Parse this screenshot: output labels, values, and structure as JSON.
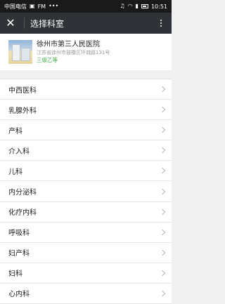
{
  "statusbar": {
    "carrier": "中国电信",
    "fm": "FM",
    "time": "10:51"
  },
  "navbar": {
    "title": "选择科室"
  },
  "hospital": {
    "name": "徐州市第三人民医院",
    "address": "江苏省徐州市鼓楼区环城路131号",
    "level": "三级乙等"
  },
  "departments": [
    "中西医科",
    "乳腺外科",
    "产科",
    "介入科",
    "儿科",
    "内分泌科",
    "化疗内科",
    "呼吸科",
    "妇产科",
    "妇科",
    "心内科"
  ],
  "colors": {
    "navbar": "#2f3237",
    "level": "#3aa847"
  }
}
